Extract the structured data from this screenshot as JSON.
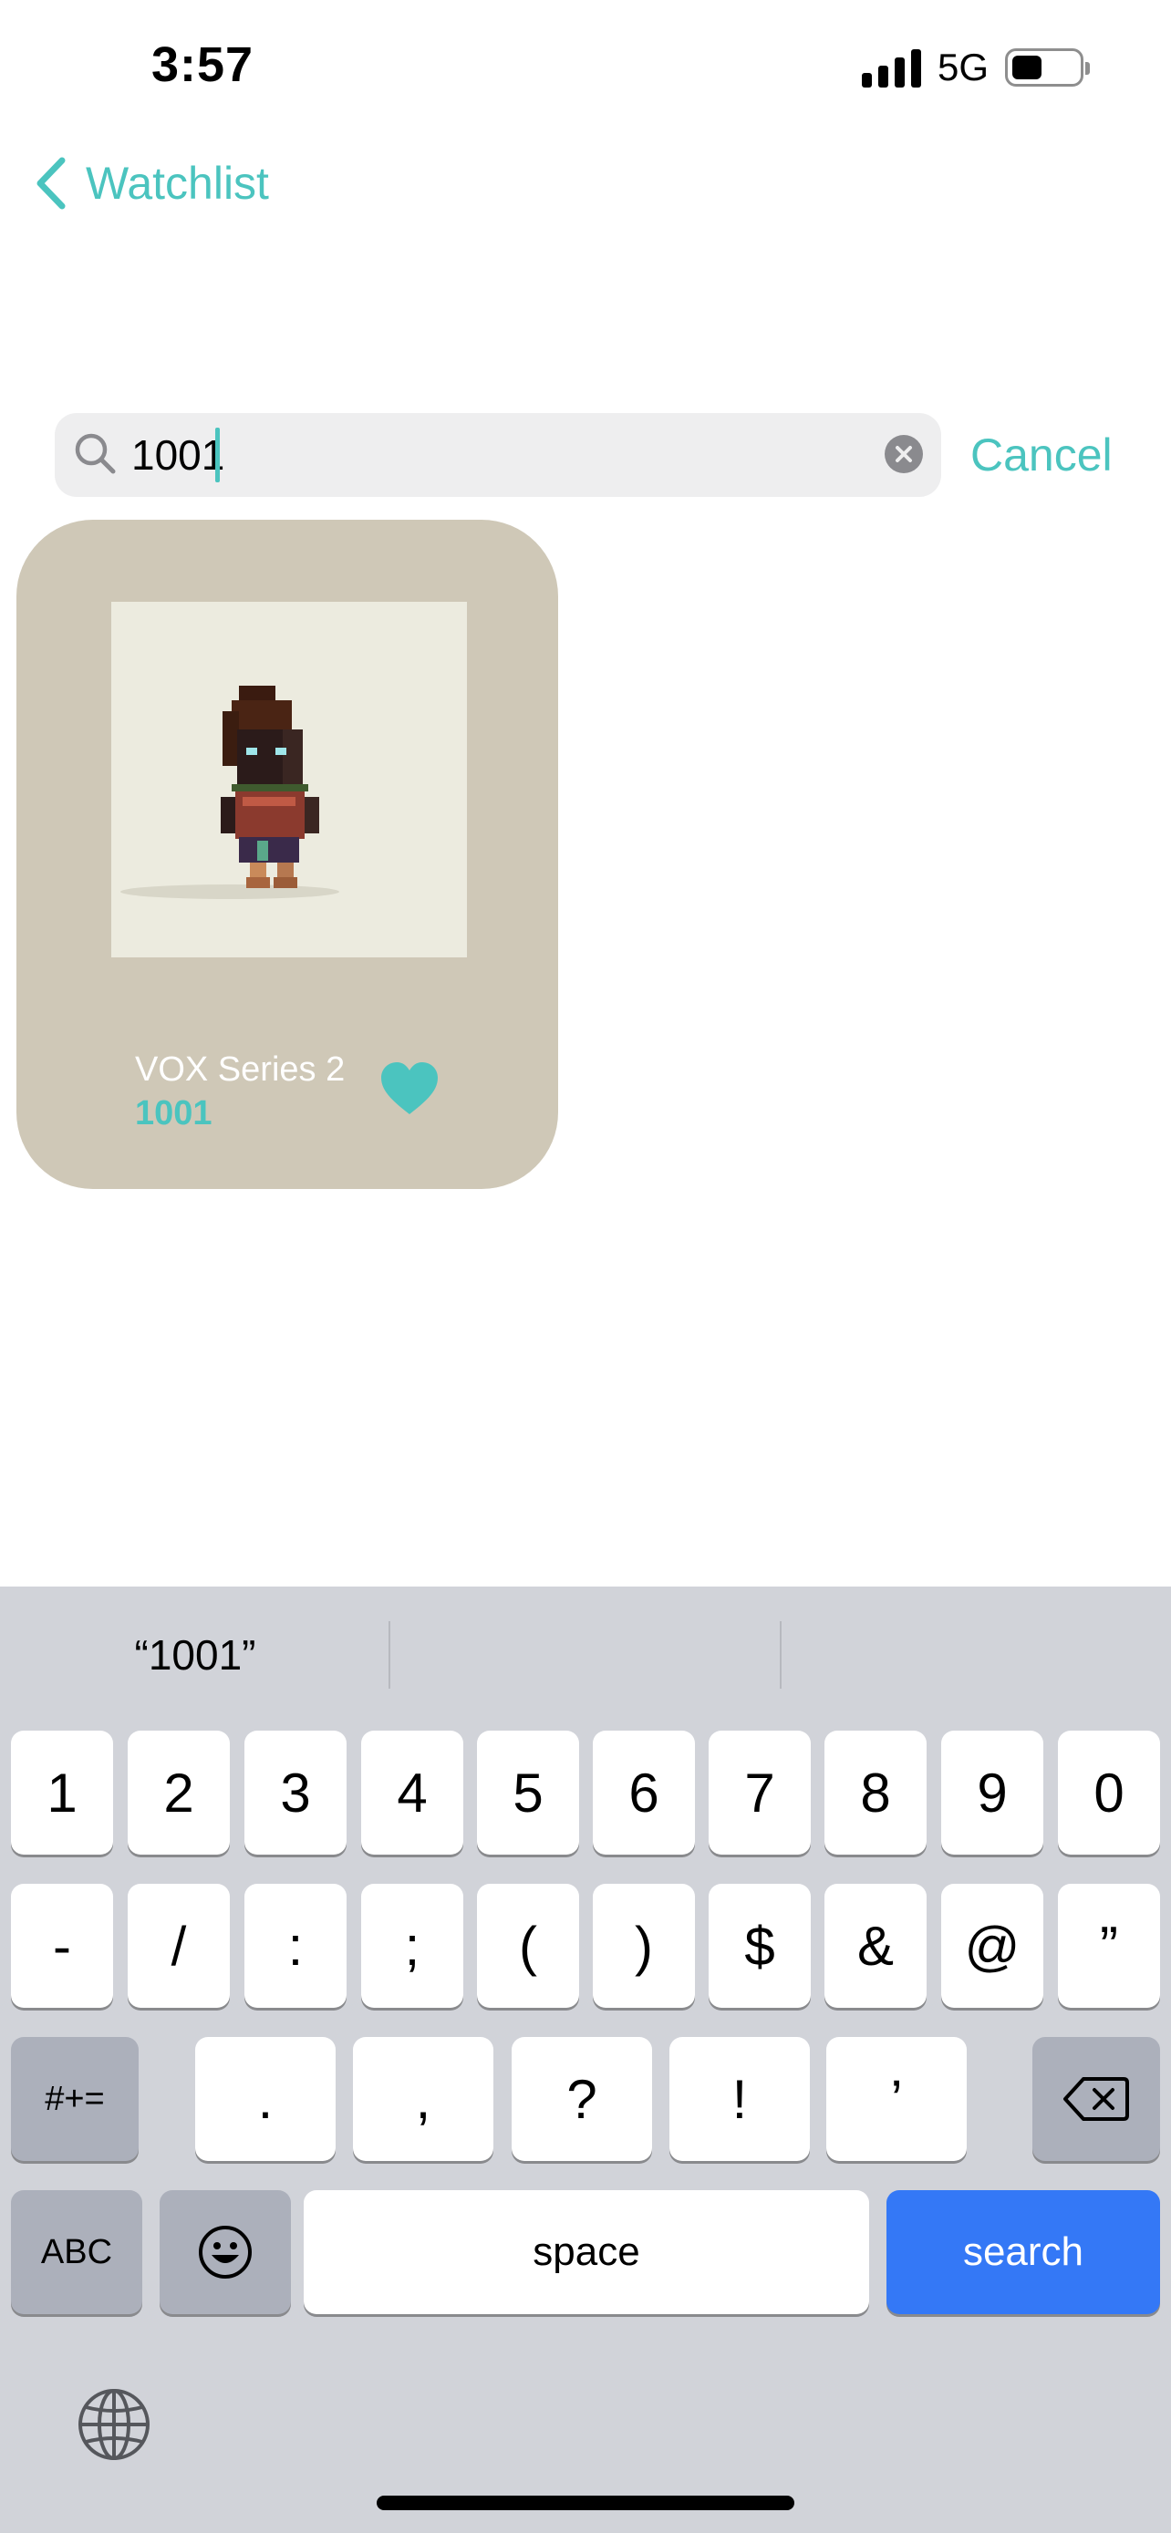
{
  "status_bar": {
    "time": "3:57",
    "network": "5G",
    "battery_level": 0.45
  },
  "nav": {
    "back_label": "Watchlist",
    "back_icon": "chevron-left-icon"
  },
  "search": {
    "value": "1001",
    "cancel_label": "Cancel"
  },
  "results": [
    {
      "collection": "VOX Series 2",
      "token_id": "1001",
      "favorited": true,
      "card_color": "#cfc8b7"
    }
  ],
  "keyboard": {
    "suggestion": "“1001”",
    "row1": [
      "1",
      "2",
      "3",
      "4",
      "5",
      "6",
      "7",
      "8",
      "9",
      "0"
    ],
    "row2": [
      "-",
      "/",
      ":",
      ";",
      "(",
      ")",
      "$",
      "&",
      "@",
      "”"
    ],
    "row3": [
      ".",
      ",",
      "?",
      "!",
      "’"
    ],
    "row3_left": "#+=",
    "abc": "ABC",
    "space": "space",
    "search": "search"
  },
  "colors": {
    "accent": "#4bc4bf",
    "search_key": "#3478f6"
  }
}
